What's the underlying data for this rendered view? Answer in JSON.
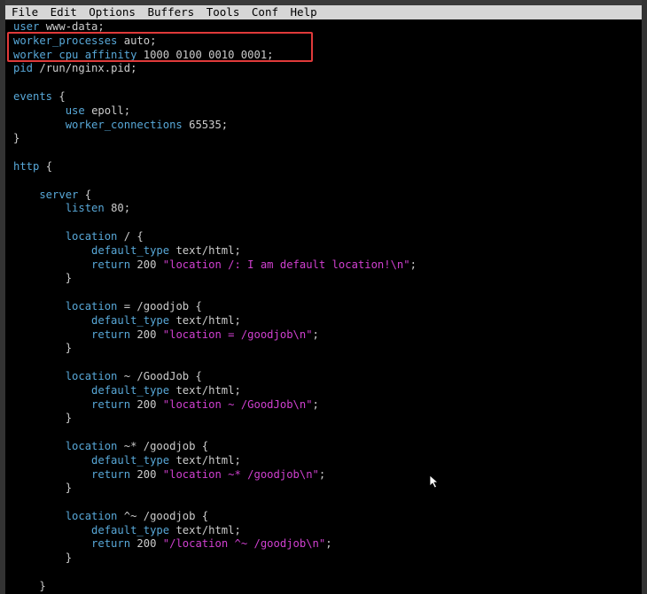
{
  "menubar": {
    "items": [
      "File",
      "Edit",
      "Options",
      "Buffers",
      "Tools",
      "Conf",
      "Help"
    ]
  },
  "code_lines": [
    [
      {
        "t": "user ",
        "c": "kw"
      },
      {
        "t": "www-data;",
        "c": "plain"
      }
    ],
    [
      {
        "t": "worker_processes ",
        "c": "kw"
      },
      {
        "t": "auto;",
        "c": "plain"
      }
    ],
    [
      {
        "t": "worker_cpu_affinity ",
        "c": "kw"
      },
      {
        "t": "1000 0100 0010 0001;",
        "c": "plain"
      }
    ],
    [
      {
        "t": "pid ",
        "c": "kw"
      },
      {
        "t": "/run/nginx.pid;",
        "c": "plain"
      }
    ],
    [],
    [
      {
        "t": "events ",
        "c": "kw"
      },
      {
        "t": "{",
        "c": "plain"
      }
    ],
    [
      {
        "t": "        use ",
        "c": "kw"
      },
      {
        "t": "epoll;",
        "c": "plain"
      }
    ],
    [
      {
        "t": "        worker_connections ",
        "c": "kw"
      },
      {
        "t": "65535;",
        "c": "plain"
      }
    ],
    [
      {
        "t": "}",
        "c": "plain"
      }
    ],
    [],
    [
      {
        "t": "http ",
        "c": "kw"
      },
      {
        "t": "{",
        "c": "plain"
      }
    ],
    [],
    [
      {
        "t": "    server ",
        "c": "kw"
      },
      {
        "t": "{",
        "c": "plain"
      }
    ],
    [
      {
        "t": "        listen ",
        "c": "kw"
      },
      {
        "t": "80;",
        "c": "plain"
      }
    ],
    [],
    [
      {
        "t": "        location ",
        "c": "kw"
      },
      {
        "t": "/ {",
        "c": "plain"
      }
    ],
    [
      {
        "t": "            default_type ",
        "c": "kw"
      },
      {
        "t": "text/html;",
        "c": "plain"
      }
    ],
    [
      {
        "t": "            return ",
        "c": "kw"
      },
      {
        "t": "200 ",
        "c": "plain"
      },
      {
        "t": "\"location /: I am default location!\\n\"",
        "c": "str"
      },
      {
        "t": ";",
        "c": "plain"
      }
    ],
    [
      {
        "t": "        }",
        "c": "plain"
      }
    ],
    [],
    [
      {
        "t": "        location ",
        "c": "kw"
      },
      {
        "t": "= /goodjob {",
        "c": "plain"
      }
    ],
    [
      {
        "t": "            default_type ",
        "c": "kw"
      },
      {
        "t": "text/html;",
        "c": "plain"
      }
    ],
    [
      {
        "t": "            return ",
        "c": "kw"
      },
      {
        "t": "200 ",
        "c": "plain"
      },
      {
        "t": "\"location = /goodjob\\n\"",
        "c": "str"
      },
      {
        "t": ";",
        "c": "plain"
      }
    ],
    [
      {
        "t": "        }",
        "c": "plain"
      }
    ],
    [],
    [
      {
        "t": "        location ",
        "c": "kw"
      },
      {
        "t": "~ /GoodJob {",
        "c": "plain"
      }
    ],
    [
      {
        "t": "            default_type ",
        "c": "kw"
      },
      {
        "t": "text/html;",
        "c": "plain"
      }
    ],
    [
      {
        "t": "            return ",
        "c": "kw"
      },
      {
        "t": "200 ",
        "c": "plain"
      },
      {
        "t": "\"location ~ /GoodJob\\n\"",
        "c": "str"
      },
      {
        "t": ";",
        "c": "plain"
      }
    ],
    [
      {
        "t": "        }",
        "c": "plain"
      }
    ],
    [],
    [
      {
        "t": "        location ",
        "c": "kw"
      },
      {
        "t": "~* /goodjob {",
        "c": "plain"
      }
    ],
    [
      {
        "t": "            default_type ",
        "c": "kw"
      },
      {
        "t": "text/html;",
        "c": "plain"
      }
    ],
    [
      {
        "t": "            return ",
        "c": "kw"
      },
      {
        "t": "200 ",
        "c": "plain"
      },
      {
        "t": "\"location ~* /goodjob\\n\"",
        "c": "str"
      },
      {
        "t": ";",
        "c": "plain"
      }
    ],
    [
      {
        "t": "        }",
        "c": "plain"
      }
    ],
    [],
    [
      {
        "t": "        location ",
        "c": "kw"
      },
      {
        "t": "^~ /goodjob {",
        "c": "plain"
      }
    ],
    [
      {
        "t": "            default_type ",
        "c": "kw"
      },
      {
        "t": "text/html;",
        "c": "plain"
      }
    ],
    [
      {
        "t": "            return ",
        "c": "kw"
      },
      {
        "t": "200 ",
        "c": "plain"
      },
      {
        "t": "\"/location ^~ /goodjob\\n\"",
        "c": "str"
      },
      {
        "t": ";",
        "c": "plain"
      }
    ],
    [
      {
        "t": "        }",
        "c": "plain"
      }
    ],
    [],
    [
      {
        "t": "    }",
        "c": "plain"
      }
    ]
  ],
  "colors": {
    "directive": "#58a8d8",
    "string": "#d040d0",
    "text": "#cccccc",
    "highlight_border": "#e03a3a"
  }
}
